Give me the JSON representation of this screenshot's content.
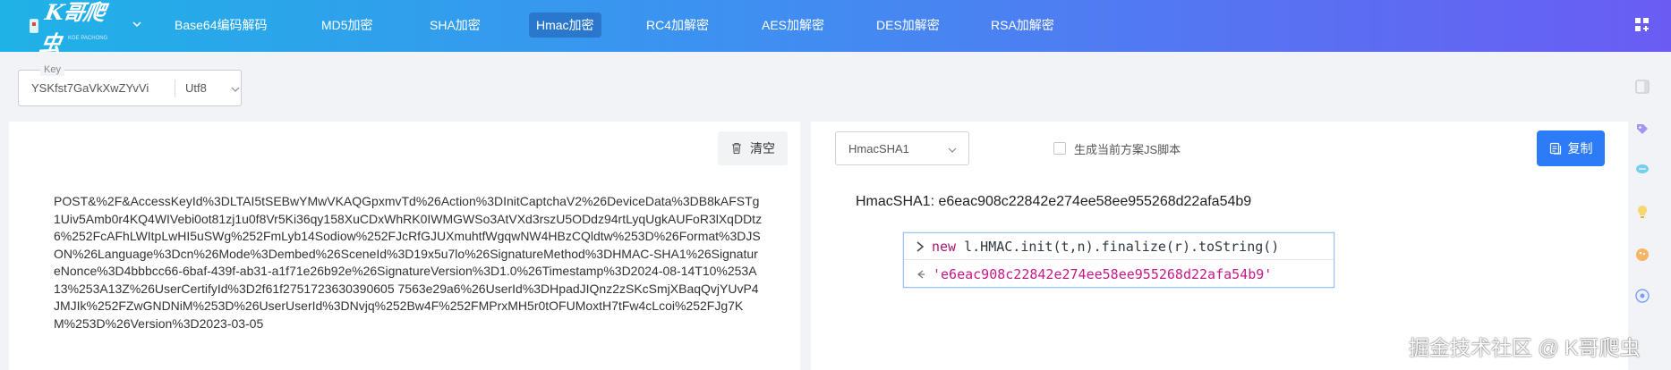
{
  "nav": {
    "logo_text": "K哥爬虫",
    "logo_sub": "KGE PACHONG",
    "items": [
      {
        "label": "Base64编码解码",
        "active": false
      },
      {
        "label": "MD5加密",
        "active": false
      },
      {
        "label": "SHA加密",
        "active": false
      },
      {
        "label": "Hmac加密",
        "active": true
      },
      {
        "label": "RC4加解密",
        "active": false
      },
      {
        "label": "AES加解密",
        "active": false
      },
      {
        "label": "DES加解密",
        "active": false
      },
      {
        "label": "RSA加解密",
        "active": false
      }
    ]
  },
  "key": {
    "label": "Key",
    "value": "YSKfst7GaVkXwZYvVi",
    "encoding": "Utf8"
  },
  "left": {
    "clear_label": "清空",
    "input_text": "POST&%2F&AccessKeyId%3DLTAI5tSEBwYMwVKAQGpxmvTd%26Action%3DInitCaptchaV2%26DeviceData%3DB8kAFSTg1Uiv5Amb0r4KQ4WIVebi0ot81zj1u0f8Vr5Ki36qy158XuCDxWhRK0IWMGWSo3AtVXd3rszU5ODdz94rtLyqUgkAUFoR3lXqDDtz6%252FcAFhLWItpLwHI5uSWg%252FmLyb14Sodiow%252FJcRfGJUXmuhtfWgqwNW4HBzCQldtw%253D%26Format%3DJSON%26Language%3Dcn%26Mode%3Dembed%26SceneId%3D19x5u7lo%26SignatureMethod%3DHMAC-SHA1%26SignatureNonce%3D4bbbcc66-6baf-439f-ab31-a1f71e26b92e%26SignatureVersion%3D1.0%26Timestamp%3D2024-08-14T10%253A13%253A13Z%26UserCertifyId%3D2f61f2751723630390605 7563e29a6%26UserId%3DHpadJIQnz2zSKcSmjXBaqQvjYUvP4JMJIk%252FZwGNDNiM%253D%26UserUserId%3DNvjq%252Bw4F%252FMPrxMH5r0tOFUMoxtH7tFw4cLcoi%252FJg7KM%253D%26Version%3D2023-03-05"
  },
  "right": {
    "algorithm": "HmacSHA1",
    "checkbox_label": "生成当前方案JS脚本",
    "copy_label": "复制",
    "result": "HmacSHA1: e6eac908c22842e274ee58ee955268d22afa54b9"
  },
  "console": {
    "keyword": "new",
    "code": " l.HMAC.init(t,n).finalize(r).toString()",
    "output": "'e6eac908c22842e274ee58ee955268d22afa54b9'"
  },
  "watermark": "掘金技术社区 @ K哥爬虫",
  "colors": {
    "nav_start": "#1fb2e6",
    "nav_end": "#6a5cf3",
    "primary_button": "#2b7cf6",
    "console_keyword": "#a8186f",
    "console_string": "#c41a88"
  }
}
